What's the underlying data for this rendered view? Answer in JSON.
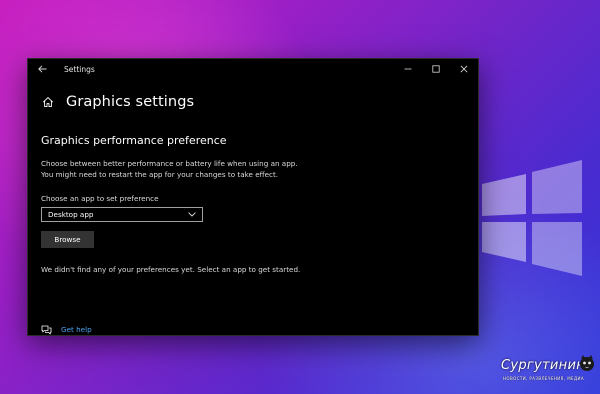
{
  "window": {
    "title": "Settings"
  },
  "page": {
    "title": "Graphics settings"
  },
  "section": {
    "title": "Graphics performance preference",
    "description_line1": "Choose between better performance or battery life when using an app.",
    "description_line2": "You might need to restart the app for your changes to take effect."
  },
  "app_selector": {
    "label": "Choose an app to set preference",
    "selected_value": "Desktop app",
    "browse_label": "Browse"
  },
  "notice": "We didn't find any of your preferences yet. Select an app to get started.",
  "help": {
    "link_label": "Get help"
  },
  "watermark": {
    "brand": "Сургутинин",
    "tagline": "НОВОСТИ, РАЗВЛЕЧЕНИЯ, МЕДИА"
  },
  "colors": {
    "window_bg": "#000000",
    "link": "#4aa3f0",
    "button_bg": "#333333",
    "wallpaper_primary": "#9a1fc6"
  },
  "icons": {
    "back": "back-arrow-icon",
    "home": "home-icon",
    "minimize": "minimize-icon",
    "maximize": "maximize-icon",
    "close": "close-icon",
    "dropdown": "chevron-down-icon",
    "help": "help-chat-icon"
  }
}
